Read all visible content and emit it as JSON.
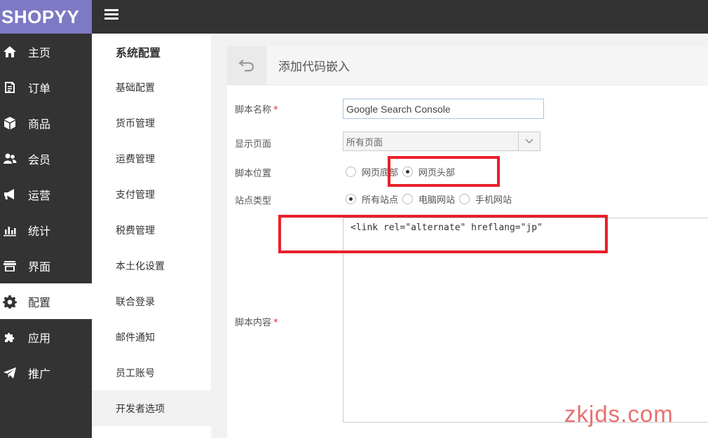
{
  "app": {
    "logo": "SHOPYY"
  },
  "topbar": {
    "menu_icon": "hamburger-icon"
  },
  "sidebar": {
    "items": [
      {
        "label": "主页",
        "icon": "home-icon"
      },
      {
        "label": "订单",
        "icon": "order-icon"
      },
      {
        "label": "商品",
        "icon": "box-icon"
      },
      {
        "label": "会员",
        "icon": "users-icon"
      },
      {
        "label": "运营",
        "icon": "megaphone-icon"
      },
      {
        "label": "统计",
        "icon": "bar-chart-icon"
      },
      {
        "label": "界面",
        "icon": "store-icon"
      },
      {
        "label": "配置",
        "icon": "gear-icon",
        "active": true
      },
      {
        "label": "应用",
        "icon": "puzzle-icon"
      },
      {
        "label": "推广",
        "icon": "paper-plane-icon"
      }
    ]
  },
  "subnav": {
    "title": "系统配置",
    "items": [
      {
        "label": "基础配置"
      },
      {
        "label": "货币管理"
      },
      {
        "label": "运费管理"
      },
      {
        "label": "支付管理"
      },
      {
        "label": "税费管理"
      },
      {
        "label": "本土化设置"
      },
      {
        "label": "联合登录"
      },
      {
        "label": "邮件通知"
      },
      {
        "label": "员工账号"
      },
      {
        "label": "开发者选项",
        "active": true
      }
    ]
  },
  "panel": {
    "title": "添加代码嵌入",
    "back_icon": "back-arrow-icon",
    "form": {
      "script_name_label": "脚本名称",
      "required_mark": "*",
      "script_name_value": "Google Search Console",
      "display_page_label": "显示页面",
      "display_page_value": "所有页面",
      "script_position_label": "脚本位置",
      "position_options": [
        "网页底部",
        "网页头部"
      ],
      "position_selected": "网页头部",
      "site_type_label": "站点类型",
      "site_type_options": [
        "所有站点",
        "电脑网站",
        "手机网站"
      ],
      "site_type_selected": "所有站点",
      "script_content_label": "脚本内容",
      "script_content_value": "<link rel=\"alternate\" hreflang=\"jp\""
    }
  },
  "watermark": "zkjds.com",
  "colors": {
    "logo_bg": "#7e79c4",
    "sidebar_bg": "#333333",
    "highlight": "#e8202a"
  }
}
